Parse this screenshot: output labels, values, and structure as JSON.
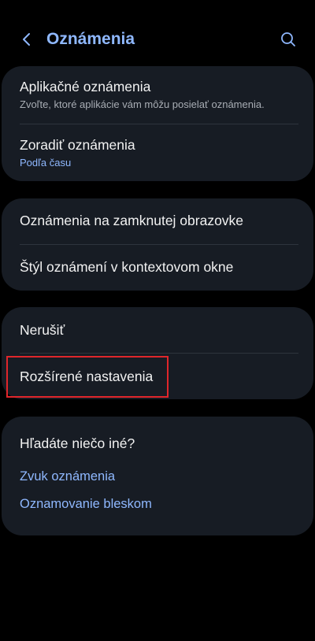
{
  "header": {
    "title": "Oznámenia",
    "back_icon": "chevron-left-icon",
    "search_icon": "search-icon"
  },
  "card1": {
    "items": [
      {
        "title": "Aplikačné oznámenia",
        "subtitle": "Zvoľte, ktoré aplikácie vám môžu posielať oznámenia."
      },
      {
        "title": "Zoradiť oznámenia",
        "subtitle": "Podľa času"
      }
    ]
  },
  "card2": {
    "items": [
      {
        "title": "Oznámenia na zamknutej obrazovke"
      },
      {
        "title": "Štýl oznámení v kontextovom okne"
      }
    ]
  },
  "card3": {
    "items": [
      {
        "title": "Nerušiť"
      },
      {
        "title": "Rozšírené nastavenia"
      }
    ]
  },
  "card4": {
    "heading": "Hľadáte niečo iné?",
    "links": [
      "Zvuk oznámenia",
      "Oznamovanie bleskom"
    ]
  },
  "colors": {
    "background": "#000000",
    "card": "#171c24",
    "accent": "#8fb8ff",
    "highlight": "#e0262b"
  }
}
